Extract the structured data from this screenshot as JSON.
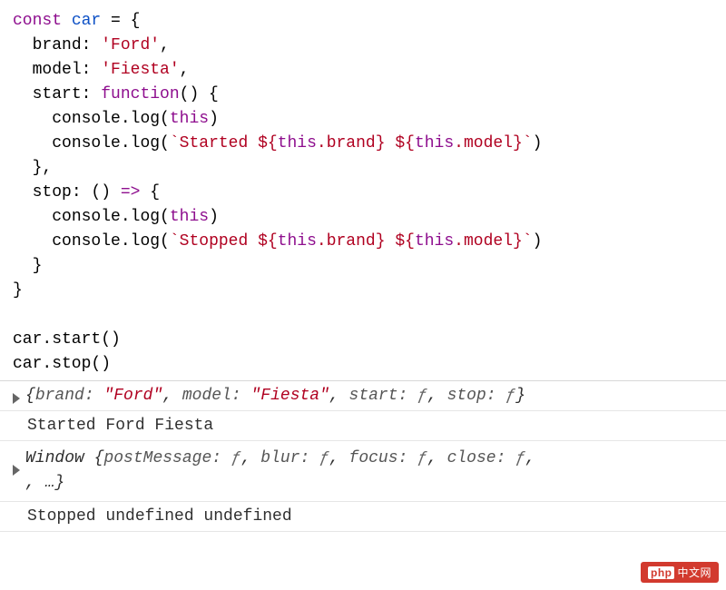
{
  "code": {
    "l1": {
      "const": "const",
      "car": "car",
      "eq": " = {"
    },
    "l2": {
      "key": "brand",
      "val": "'Ford'",
      "comma": ","
    },
    "l3": {
      "key": "model",
      "val": "'Fiesta'",
      "comma": ","
    },
    "l4": {
      "key": "start",
      "fn": "function",
      "sig": "() {"
    },
    "l5": {
      "console": "console",
      "log": ".log(",
      "this": "this",
      "close": ")"
    },
    "l6": {
      "console": "console",
      "log": ".log(",
      "bt1": "`Started ",
      "d1": "${",
      "this1": "this",
      "b1": ".brand",
      "e1": "}",
      "sp": " ",
      "d2": "${",
      "this2": "this",
      "b2": ".model",
      "e2": "}",
      "bt2": "`",
      "close": ")"
    },
    "l7": {
      "close": "},"
    },
    "l8": {
      "key": "stop",
      "arrow": ": () ",
      "fat": "=>",
      "brace": " {"
    },
    "l9": {
      "console": "console",
      "log": ".log(",
      "this": "this",
      "close": ")"
    },
    "l10": {
      "console": "console",
      "log": ".log(",
      "bt1": "`Stopped ",
      "d1": "${",
      "this1": "this",
      "b1": ".brand",
      "e1": "}",
      "sp": " ",
      "d2": "${",
      "this2": "this",
      "b2": ".model",
      "e2": "}",
      "bt2": "`",
      "close": ")"
    },
    "l11": {
      "close": "}"
    },
    "l12": {
      "close": "}"
    },
    "l14": {
      "call": "car.start()"
    },
    "l15": {
      "call": "car.stop()"
    }
  },
  "console": {
    "obj1": {
      "open": "{",
      "k1": "brand: ",
      "v1": "\"Ford\"",
      "c1": ", ",
      "k2": "model: ",
      "v2": "\"Fiesta\"",
      "c2": ", ",
      "k3": "start: ",
      "f1": "ƒ",
      "c3": ", ",
      "k4": "stop: ",
      "f2": "ƒ",
      "close": "}"
    },
    "started": "Started Ford Fiesta",
    "window": {
      "pre": "Window ",
      "open": "{",
      "k1": "postMessage: ",
      "f1": "ƒ",
      "c1": ", ",
      "k2": "blur: ",
      "f2": "ƒ",
      "c2": ", ",
      "k3": "focus: ",
      "f3": "ƒ",
      "c3": ", ",
      "k4": "close: ",
      "f4": "ƒ",
      "c4": ",",
      "more": ", …}",
      "sp": " "
    },
    "stopped": "Stopped undefined undefined"
  },
  "logo": {
    "p": "php",
    "text": "中文网"
  }
}
